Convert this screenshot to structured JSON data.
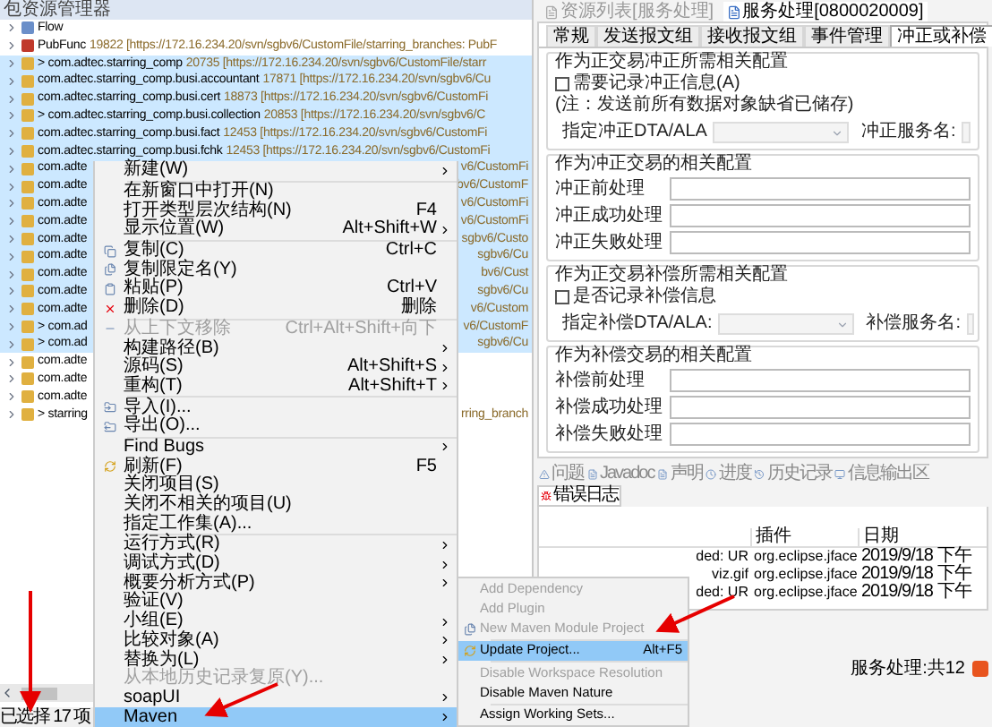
{
  "explorer": {
    "title": "包资源管理器",
    "rows": [
      {
        "name": "Flow",
        "selected": false
      },
      {
        "name": "PubFunc",
        "detail": "19822 [https://172.16.234.20/svn/sgbv6/CustomFile/starring_branches: PubF",
        "selected": false
      },
      {
        "name": "> com.adtec.starring_comp",
        "detail": "20735 [https://172.16.234.20/svn/sgbv6/CustomFile/starr",
        "selected": true
      },
      {
        "name": "com.adtec.starring_comp.busi.accountant",
        "detail": "17871 [https://172.16.234.20/svn/sgbv6/Cu",
        "selected": true
      },
      {
        "name": "com.adtec.starring_comp.busi.cert",
        "detail": "18873 [https://172.16.234.20/svn/sgbv6/CustomFi",
        "selected": true
      },
      {
        "name": "> com.adtec.starring_comp.busi.collection",
        "detail": "20853 [https://172.16.234.20/svn/sgbv6/C",
        "selected": true
      },
      {
        "name": "com.adtec.starring_comp.busi.fact",
        "detail": "12453 [https://172.16.234.20/svn/sgbv6/CustomFi",
        "selected": true
      },
      {
        "name": "com.adtec.starring_comp.busi.fchk",
        "detail": "12453 [https://172.16.234.20/svn/sgbv6/CustomFi",
        "selected": true
      },
      {
        "name": "com.adte",
        "right": "v6/CustomFi",
        "selected": true
      },
      {
        "name": "com.adte",
        "right": "bv6/CustomF",
        "selected": true
      },
      {
        "name": "com.adte",
        "right": "v6/CustomFi",
        "selected": true
      },
      {
        "name": "com.adte",
        "right": "v6/CustomFi",
        "selected": true
      },
      {
        "name": "com.adte",
        "right": "sgbv6/Custo",
        "selected": true
      },
      {
        "name": "com.adte",
        "right": "sgbv6/Cu",
        "selected": true
      },
      {
        "name": "com.adte",
        "right": "bv6/Cust",
        "selected": true
      },
      {
        "name": "com.adte",
        "right": "sgbv6/Cu",
        "selected": true
      },
      {
        "name": "com.adte",
        "right": "v6/Custom",
        "selected": true
      },
      {
        "name": "> com.ad",
        "right": "v6/CustomF",
        "selected": true
      },
      {
        "name": "> com.ad",
        "right": "sgbv6/Cu",
        "selected": true
      },
      {
        "name": "com.adte",
        "selected": false
      },
      {
        "name": "com.adte",
        "selected": false
      },
      {
        "name": "com.adte",
        "selected": false
      },
      {
        "name": "> starring",
        "right": "rring_branch",
        "selected": false
      }
    ]
  },
  "context_menu": {
    "items": [
      {
        "kind": "item",
        "label": "新建(W)",
        "submenu": true,
        "disabled": false,
        "selected": false
      },
      {
        "kind": "separator"
      },
      {
        "kind": "item",
        "label": "在新窗口中打开(N)",
        "submenu": false,
        "disabled": false,
        "selected": false
      },
      {
        "kind": "item",
        "label": "打开类型层次结构(N)",
        "shortcut": "F4",
        "submenu": false,
        "disabled": false,
        "selected": false
      },
      {
        "kind": "item",
        "label": "显示位置(W)",
        "shortcut": "Alt+Shift+W",
        "submenu": true,
        "disabled": false,
        "selected": false
      },
      {
        "kind": "separator"
      },
      {
        "kind": "item",
        "label": "复制(C)",
        "shortcut": "Ctrl+C",
        "submenu": false,
        "disabled": false,
        "selected": false
      },
      {
        "kind": "item",
        "label": "复制限定名(Y)",
        "submenu": false,
        "disabled": false,
        "selected": false
      },
      {
        "kind": "item",
        "label": "粘贴(P)",
        "shortcut": "Ctrl+V",
        "submenu": false,
        "disabled": false,
        "selected": false
      },
      {
        "kind": "item",
        "label": "删除(D)",
        "shortcut": "删除",
        "submenu": false,
        "disabled": false,
        "selected": false
      },
      {
        "kind": "separator"
      },
      {
        "kind": "item",
        "label": "从上下文移除",
        "shortcut": "Ctrl+Alt+Shift+向下",
        "submenu": false,
        "disabled": true,
        "selected": false
      },
      {
        "kind": "item",
        "label": "构建路径(B)",
        "submenu": true,
        "disabled": false,
        "selected": false
      },
      {
        "kind": "item",
        "label": "源码(S)",
        "shortcut": "Alt+Shift+S",
        "submenu": true,
        "disabled": false,
        "selected": false
      },
      {
        "kind": "item",
        "label": "重构(T)",
        "shortcut": "Alt+Shift+T",
        "submenu": true,
        "disabled": false,
        "selected": false
      },
      {
        "kind": "separator"
      },
      {
        "kind": "item",
        "label": "导入(I)...",
        "submenu": false,
        "disabled": false,
        "selected": false
      },
      {
        "kind": "item",
        "label": "导出(O)...",
        "submenu": false,
        "disabled": false,
        "selected": false
      },
      {
        "kind": "separator"
      },
      {
        "kind": "item",
        "label": "Find Bugs",
        "submenu": true,
        "disabled": false,
        "selected": false
      },
      {
        "kind": "item",
        "label": "刷新(F)",
        "shortcut": "F5",
        "submenu": false,
        "disabled": false,
        "selected": false
      },
      {
        "kind": "item",
        "label": "关闭项目(S)",
        "submenu": false,
        "disabled": false,
        "selected": false
      },
      {
        "kind": "item",
        "label": "关闭不相关的项目(U)",
        "submenu": false,
        "disabled": false,
        "selected": false
      },
      {
        "kind": "item",
        "label": "指定工作集(A)...",
        "submenu": false,
        "disabled": false,
        "selected": false
      },
      {
        "kind": "separator"
      },
      {
        "kind": "item",
        "label": "运行方式(R)",
        "submenu": true,
        "disabled": false,
        "selected": false
      },
      {
        "kind": "item",
        "label": "调试方式(D)",
        "submenu": true,
        "disabled": false,
        "selected": false
      },
      {
        "kind": "item",
        "label": "概要分析方式(P)",
        "submenu": true,
        "disabled": false,
        "selected": false
      },
      {
        "kind": "item",
        "label": "验证(V)",
        "submenu": false,
        "disabled": false,
        "selected": false
      },
      {
        "kind": "item",
        "label": "小组(E)",
        "submenu": true,
        "disabled": false,
        "selected": false
      },
      {
        "kind": "item",
        "label": "比较对象(A)",
        "submenu": true,
        "disabled": false,
        "selected": false
      },
      {
        "kind": "item",
        "label": "替换为(L)",
        "submenu": true,
        "disabled": false,
        "selected": false
      },
      {
        "kind": "item",
        "label": "从本地历史记录复原(Y)...",
        "submenu": false,
        "disabled": true,
        "selected": false
      },
      {
        "kind": "item",
        "label": "soapUI",
        "submenu": true,
        "disabled": false,
        "selected": false
      },
      {
        "kind": "item",
        "label": "Maven",
        "submenu": true,
        "disabled": false,
        "selected": true
      }
    ]
  },
  "maven_submenu": {
    "items": [
      {
        "kind": "item",
        "label": "Add Dependency",
        "disabled": true,
        "selected": false
      },
      {
        "kind": "item",
        "label": "Add Plugin",
        "disabled": true,
        "selected": false
      },
      {
        "kind": "item",
        "label": "New Maven Module Project",
        "disabled": true,
        "selected": false
      },
      {
        "kind": "separator"
      },
      {
        "kind": "item",
        "label": "Update Project...",
        "shortcut": "Alt+F5",
        "disabled": false,
        "selected": true
      },
      {
        "kind": "separator"
      },
      {
        "kind": "item",
        "label": "Disable Workspace Resolution",
        "disabled": true,
        "selected": false
      },
      {
        "kind": "item",
        "label": "Disable Maven Nature",
        "disabled": false,
        "selected": false
      },
      {
        "kind": "separator"
      },
      {
        "kind": "item",
        "label": "Assign Working Sets...",
        "disabled": false,
        "selected": false
      }
    ]
  },
  "editor": {
    "tabs": [
      {
        "label": "资源列表[服务处理]",
        "selected": false
      },
      {
        "label": "服务处理[0800020009]",
        "selected": true
      }
    ],
    "page_tabs": [
      {
        "label": "常规",
        "selected": false
      },
      {
        "label": "发送报文组",
        "selected": false
      },
      {
        "label": "接收报文组",
        "selected": false
      },
      {
        "label": "事件管理",
        "selected": false
      },
      {
        "label": "冲正或补偿",
        "selected": true
      }
    ],
    "groups": [
      {
        "kind": "options",
        "title": "作为正交易冲正所需相关配置",
        "checkbox": {
          "label": "需要记录冲正信息(A)",
          "checked": false
        },
        "note": "(注：发送前所有数据对象缺省已储存)",
        "dta_label": "指定冲正DTA/ALA",
        "service_label": "冲正服务名:"
      },
      {
        "kind": "fields",
        "title": "作为冲正交易的相关配置",
        "fields": [
          "冲正前处理",
          "冲正成功处理",
          "冲正失败处理"
        ]
      },
      {
        "kind": "options",
        "title": "作为正交易补偿所需相关配置",
        "checkbox": {
          "label": "是否记录补偿信息",
          "checked": false
        },
        "dta_label": "指定补偿DTA/ALA:",
        "service_label": "补偿服务名:"
      },
      {
        "kind": "fields",
        "title": "作为补偿交易的相关配置",
        "fields": [
          "补偿前处理",
          "补偿成功处理",
          "补偿失败处理"
        ]
      }
    ]
  },
  "bottom_panel": {
    "tabs": [
      {
        "label": "问题",
        "selected": false
      },
      {
        "label": "Javadoc",
        "selected": false
      },
      {
        "label": "声明",
        "selected": false
      },
      {
        "label": "进度",
        "selected": false
      },
      {
        "label": "历史记录",
        "selected": false
      },
      {
        "label": "信息输出区",
        "selected": false
      },
      {
        "label": "错误日志",
        "selected": true
      }
    ],
    "table": {
      "columns": [
        "插件",
        "日期"
      ],
      "rows": [
        {
          "message": "ded: UR",
          "plugin": "org.eclipse.jface",
          "date": "2019/9/18 下午"
        },
        {
          "message": "viz.gif",
          "plugin": "org.eclipse.jface",
          "date": "2019/9/18 下午"
        },
        {
          "message": "ded: UR",
          "plugin": "org.eclipse.jface",
          "date": "2019/9/18 下午"
        }
      ]
    }
  },
  "status_bar": {
    "selection": "已选择 17 项",
    "service": "服务处理:共12"
  }
}
